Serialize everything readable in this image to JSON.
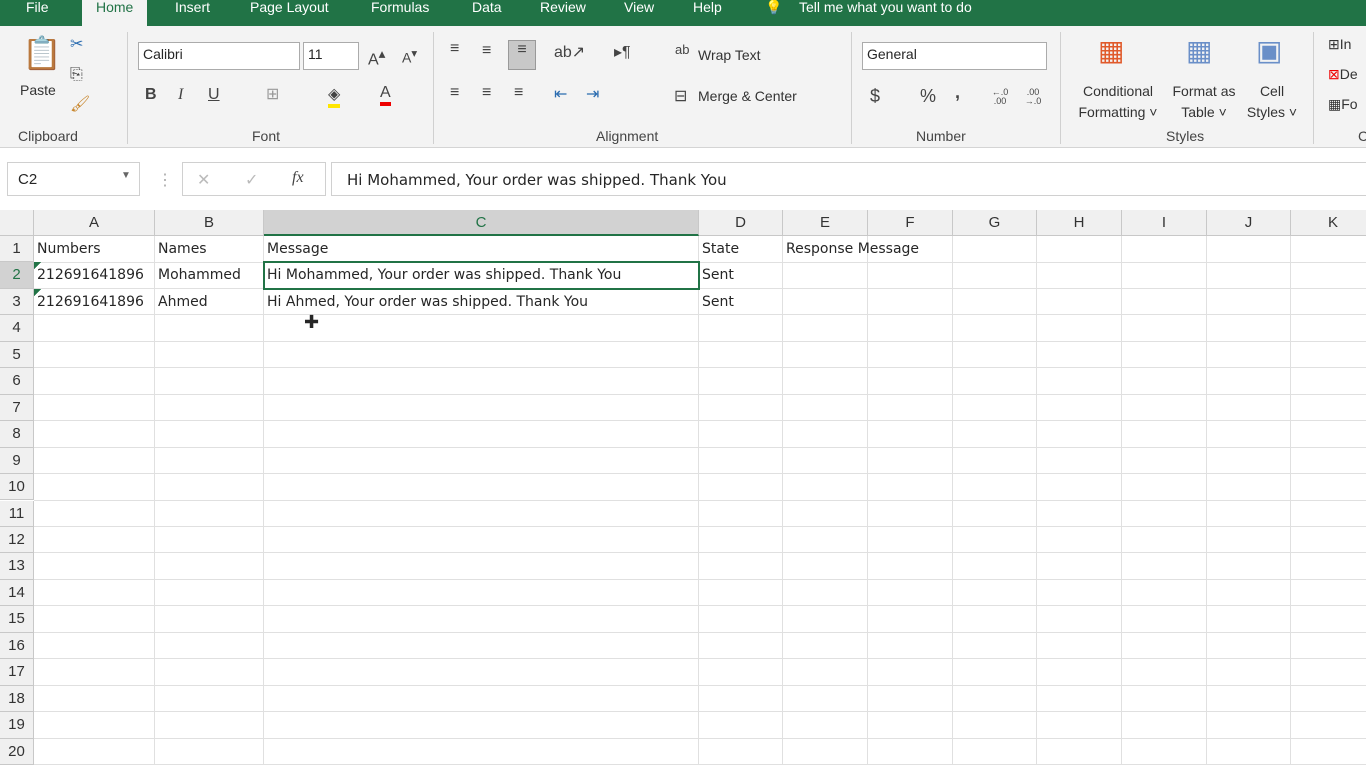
{
  "tabs": [
    "File",
    "Home",
    "Insert",
    "Page Layout",
    "Formulas",
    "Data",
    "Review",
    "View",
    "Help"
  ],
  "tell_me": "Tell me what you want to do",
  "clipboard": {
    "paste": "Paste",
    "label": "Clipboard"
  },
  "font": {
    "name": "Calibri",
    "size": "11",
    "bold": "B",
    "italic": "I",
    "underline": "U",
    "label": "Font"
  },
  "alignment": {
    "wrap": "Wrap Text",
    "merge": "Merge & Center",
    "label": "Alignment"
  },
  "number": {
    "format": "General",
    "currency": "$",
    "percent": "%",
    "comma": ",",
    "inc": "←.0 .00",
    "dec": ".00 →.0",
    "label": "Number"
  },
  "styles": {
    "cond1": "Conditional",
    "cond2": "Formatting",
    "fmt1": "Format as",
    "fmt2": "Table",
    "cell1": "Cell",
    "cell2": "Styles",
    "label": "Styles"
  },
  "cells_group": {
    "insert": "In",
    "delete": "De",
    "format": "Fo",
    "label": "C"
  },
  "formula_bar": {
    "name_box": "C2",
    "fx": "fx",
    "value": "Hi Mohammed, Your order was shipped. Thank You"
  },
  "columns": [
    "A",
    "B",
    "C",
    "D",
    "E",
    "F",
    "G",
    "H",
    "I",
    "J",
    "K"
  ],
  "rows": 20,
  "cells": [
    [
      "Numbers",
      "Names",
      "Message",
      "State",
      "Response Message"
    ],
    [
      "212691641896",
      "Mohammed",
      "Hi Mohammed, Your order was shipped. Thank You",
      "Sent",
      ""
    ],
    [
      "212691641896",
      "Ahmed",
      "Hi Ahmed, Your order was shipped. Thank You",
      "Sent",
      ""
    ]
  ],
  "accent": "#217346"
}
